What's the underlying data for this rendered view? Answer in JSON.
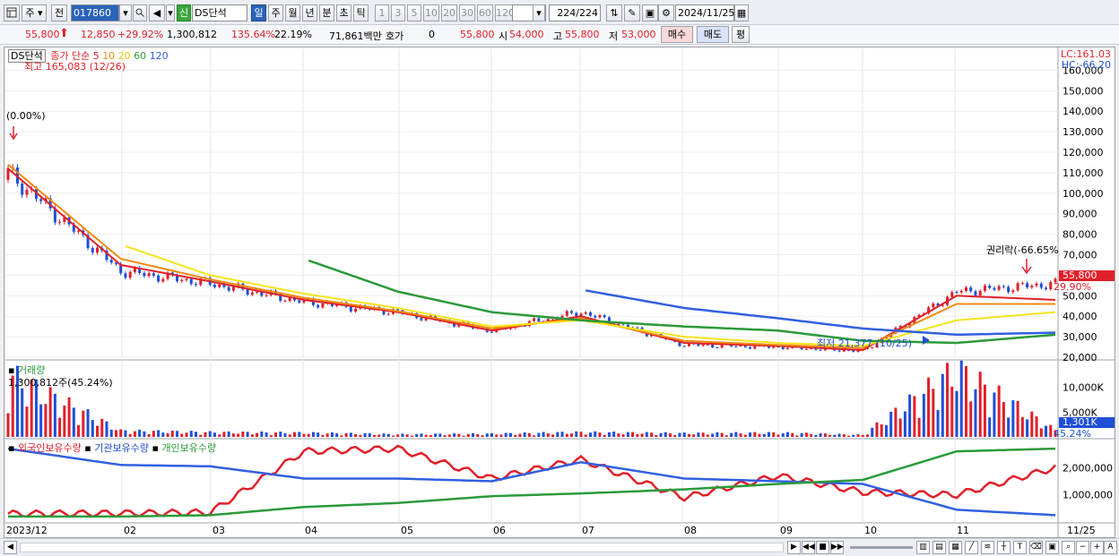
{
  "toolbar": {
    "menu_icon": "grid-menu-icon",
    "market_type": "주",
    "prev_label": "전",
    "code": "017860",
    "name_tag": "신",
    "name": "DS단석",
    "periods": [
      "일",
      "주",
      "월",
      "년",
      "분",
      "초",
      "틱"
    ],
    "intervals": [
      "1",
      "3",
      "5",
      "10",
      "20",
      "30",
      "60",
      "120"
    ],
    "count": "224",
    "count_total": "/224",
    "date": "2024/11/25"
  },
  "quote": {
    "price": "55,800",
    "change": "12,850",
    "change_pct": "+29.92%",
    "volume": "1,300,812",
    "volume_ratio": "135.64%",
    "turnover": "22.19%",
    "amount": "71,861백만",
    "hoga_label": "호가",
    "hoga_value": "0",
    "hoga_price": "55,800",
    "open_label": "시",
    "open": "54,000",
    "high_label": "고",
    "high": "55,800",
    "low_label": "저",
    "low": "53,000",
    "buy_label": "매수",
    "sell_label": "매도",
    "eval_label": "평"
  },
  "price_panel": {
    "name": "DS단석",
    "legend_prefix": "종가 단순",
    "ma_periods": [
      "5",
      "10",
      "20",
      "60",
      "120"
    ],
    "max_label": "최고 165,083 (12/26)",
    "min_label": "최저 21,377 (10/25)",
    "start_label": "(0.00%)",
    "rights_label": "권리락(-66.65%",
    "lc": "LC:161.03",
    "hc": "HC:-66.20",
    "last_price": "55,800",
    "last_pct": "29.90%",
    "y_ticks": [
      "160,000",
      "150,000",
      "140,000",
      "130,000",
      "120,000",
      "110,000",
      "100,000",
      "90,000",
      "80,000",
      "70,000",
      "60,000",
      "50,000",
      "40,000",
      "30,000",
      "20,000"
    ]
  },
  "volume_panel": {
    "title": "거래량",
    "last_volume": "1,300,812주(45.24%)",
    "y_ticks": [
      "10,000K",
      "5,000K"
    ],
    "last_badge": "1,301K",
    "last_pct": "45.24%"
  },
  "holder_panel": {
    "legend": [
      "외국인보유수량",
      "기관보유수량",
      "개인보유수량"
    ],
    "y_ticks": [
      "2,000,000",
      "1,000,000"
    ]
  },
  "x_axis": [
    "2023/12",
    "02",
    "03",
    "04",
    "05",
    "06",
    "07",
    "08",
    "09",
    "10",
    "11",
    "11/25"
  ],
  "colors": {
    "ma5": "#e0202a",
    "ma10": "#f08a10",
    "ma20": "#f5e51c",
    "ma60": "#2a9a3a",
    "ma120": "#3060e0",
    "up": "#e0202a",
    "down": "#1f4fd6"
  },
  "chart_data": [
    {
      "type": "candlestick",
      "title": "DS단석",
      "x": [
        "2023/12",
        "02",
        "03",
        "04",
        "05",
        "06",
        "07",
        "08",
        "09",
        "10",
        "11",
        "11/25"
      ],
      "series": [
        {
          "name": "종가",
          "values": [
            110000,
            62000,
            56000,
            47000,
            42000,
            33000,
            42000,
            26000,
            25000,
            23000,
            52000,
            55800
          ]
        },
        {
          "name": "5",
          "values": [
            112000,
            65000,
            57000,
            48000,
            42000,
            33000,
            40000,
            27000,
            25500,
            23500,
            50000,
            48000
          ]
        },
        {
          "name": "10",
          "values": [
            114000,
            68000,
            58000,
            49000,
            42500,
            34000,
            39000,
            28000,
            26000,
            24500,
            46000,
            46000
          ]
        },
        {
          "name": "20",
          "values": [
            null,
            75000,
            60000,
            51000,
            44000,
            35000,
            38000,
            30000,
            27000,
            25500,
            38000,
            42000
          ]
        },
        {
          "name": "60",
          "values": [
            null,
            null,
            null,
            68000,
            52000,
            42000,
            38000,
            35000,
            33000,
            28000,
            27000,
            31000
          ]
        },
        {
          "name": "120",
          "values": [
            null,
            null,
            null,
            null,
            null,
            null,
            53000,
            44000,
            39000,
            34000,
            31000,
            32000
          ]
        }
      ],
      "ylim": [
        20000,
        165000
      ]
    },
    {
      "type": "bar",
      "title": "거래량",
      "categories": [
        "2023/12",
        "02",
        "03",
        "04",
        "05",
        "06",
        "07",
        "08",
        "09",
        "10",
        "11",
        "11/25"
      ],
      "values": [
        12000,
        1200,
        900,
        800,
        500,
        600,
        900,
        700,
        800,
        400,
        13000,
        1301
      ],
      "ylim": [
        0,
        15000
      ],
      "unit": "K"
    },
    {
      "type": "line",
      "x": [
        "2023/12",
        "02",
        "03",
        "04",
        "05",
        "06",
        "07",
        "08",
        "09",
        "10",
        "11",
        "11/25"
      ],
      "series": [
        {
          "name": "외국인보유수량",
          "values": [
            300000,
            320000,
            350000,
            2600000,
            2700000,
            1600000,
            2300000,
            900000,
            1700000,
            1100000,
            1000000,
            2000000
          ]
        },
        {
          "name": "기관보유수량",
          "values": [
            2700000,
            2100000,
            2050000,
            1600000,
            1600000,
            1500000,
            2200000,
            1600000,
            1500000,
            1400000,
            450000,
            250000
          ]
        },
        {
          "name": "개인보유수량",
          "values": [
            200000,
            200000,
            250000,
            550000,
            700000,
            950000,
            1050000,
            1200000,
            1400000,
            1550000,
            2600000,
            2700000
          ]
        }
      ],
      "ylim": [
        0,
        3000000
      ]
    }
  ]
}
